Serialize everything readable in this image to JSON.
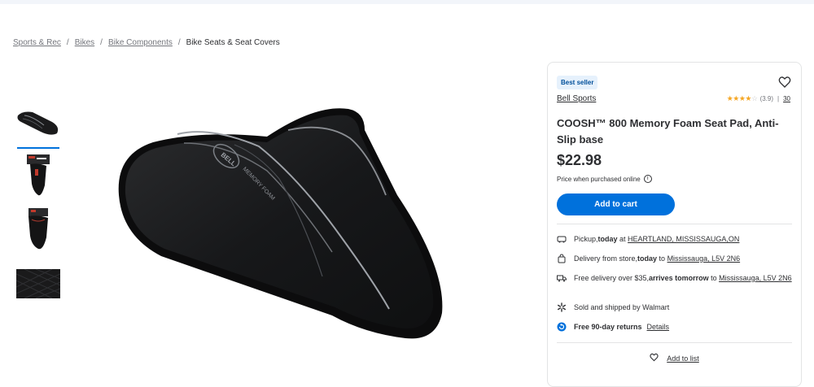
{
  "breadcrumb": {
    "items": [
      "Sports & Rec",
      "Bikes",
      "Bike Components"
    ],
    "current": "Bike Seats & Seat Covers",
    "separator": "/"
  },
  "gallery": {
    "thumbnails": [
      "seat-top-view",
      "seat-in-packaging",
      "seat-in-packaging-alt",
      "foam-texture-closeup"
    ],
    "selected_index": 0,
    "main_image_text": [
      "BELL",
      "MEMORY FOAM"
    ]
  },
  "product": {
    "badge": "Best seller",
    "brand": "Bell Sports",
    "rating": {
      "stars": 3.9,
      "value_text": "(3.9)",
      "separator": "|",
      "review_count": "30"
    },
    "title": "COOSH™ 800 Memory Foam Seat Pad, Anti-Slip base",
    "price": "$22.98",
    "price_note": "Price when purchased online",
    "add_to_cart": "Add to cart"
  },
  "fulfillment": {
    "pickup": {
      "prefix": "Pickup, ",
      "bold": "today",
      "mid": " at ",
      "link": "HEARTLAND, MISSISSAUGA,ON"
    },
    "delivery": {
      "prefix": "Delivery from store, ",
      "bold": "today",
      "mid": " to ",
      "link": "Mississauga, L5V 2N6"
    },
    "shipping": {
      "prefix": "Free delivery over $35, ",
      "bold": "arrives tomorrow",
      "mid": " to ",
      "link": "Mississauga, L5V 2N6"
    }
  },
  "seller": {
    "text": "Sold and shipped by Walmart"
  },
  "returns": {
    "bold": "Free 90-day returns",
    "link": "Details"
  },
  "add_to_list": "Add to list",
  "colors": {
    "accent": "#0071dc",
    "badge_bg": "#e6f1fc",
    "star": "#f5a623"
  },
  "icons": [
    "heart-icon",
    "info-icon",
    "pickup-truck-icon",
    "shopping-bag-icon",
    "delivery-truck-icon",
    "walmart-spark-icon",
    "return-icon"
  ]
}
